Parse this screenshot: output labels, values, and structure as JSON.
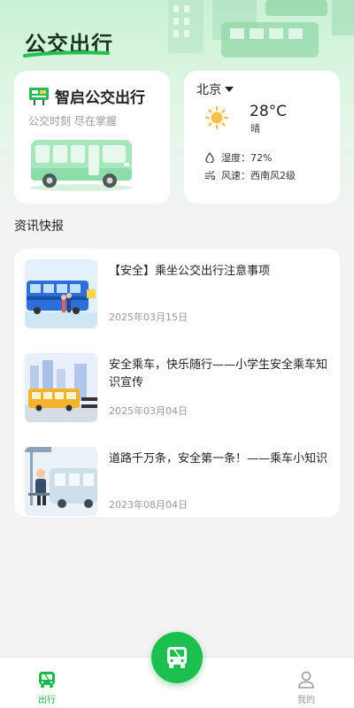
{
  "header": {
    "app_title": "公交出行"
  },
  "brand_card": {
    "name": "智启公交出行",
    "subtitle": "公交时刻 尽在掌握"
  },
  "weather": {
    "city": "北京",
    "temperature": "28°C",
    "condition": "晴",
    "humidity": "湿度：72%",
    "wind": "风速：西南风2级",
    "icons": [
      "sun-icon",
      "humidity-drop-icon",
      "wind-icon"
    ]
  },
  "news": {
    "section_title": "资讯快报",
    "items": [
      {
        "title": "【安全】乘坐公交出行注意事项",
        "date": "2025年03月15日"
      },
      {
        "title": "安全乘车，快乐随行——小学生安全乘车知识宣传",
        "date": "2025年03月04日"
      },
      {
        "title": "道路千万条，安全第一条！——乘车小知识",
        "date": "2023年08月04日"
      }
    ]
  },
  "tabbar": {
    "tabs": [
      {
        "label": "出行",
        "icon": "bus-tab-icon",
        "active": true
      },
      {
        "label": "我的",
        "icon": "user-icon",
        "active": false
      }
    ],
    "center_button_icon": "bus-front-icon"
  },
  "colors": {
    "accent": "#1cc04f",
    "active_tab": "#1cb84a",
    "inactive_tab": "#999999",
    "dark_green": "#14361f"
  }
}
